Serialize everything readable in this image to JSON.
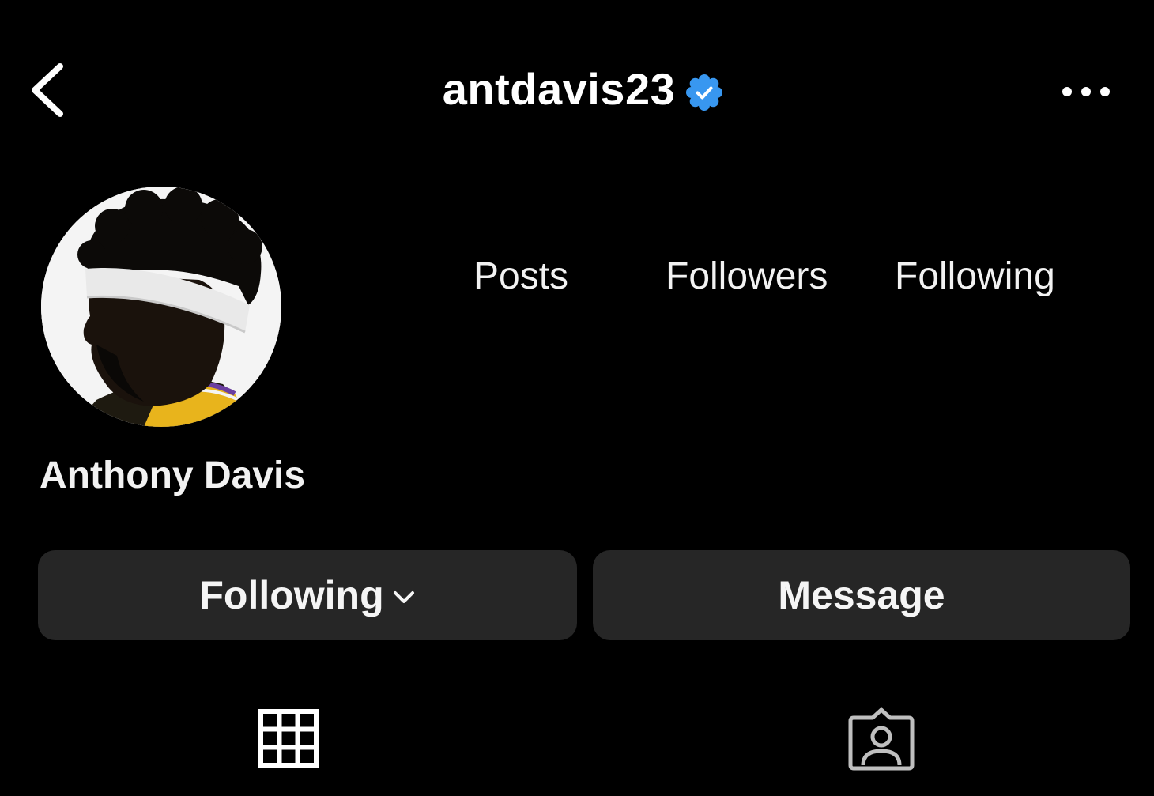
{
  "header": {
    "username": "antdavis23",
    "verified_icon": "verified-badge-icon",
    "back_icon": "chevron-left-icon",
    "more_icon": "more-horizontal-icon",
    "verified_color": "#3897f0"
  },
  "profile": {
    "display_name": "Anthony Davis",
    "avatar": "profile-photo"
  },
  "stats": {
    "posts_label": "Posts",
    "followers_label": "Followers",
    "following_label": "Following"
  },
  "actions": {
    "following_label": "Following",
    "message_label": "Message"
  },
  "tabs": [
    {
      "icon": "grid-icon"
    },
    {
      "icon": "tagged-person-icon"
    }
  ]
}
